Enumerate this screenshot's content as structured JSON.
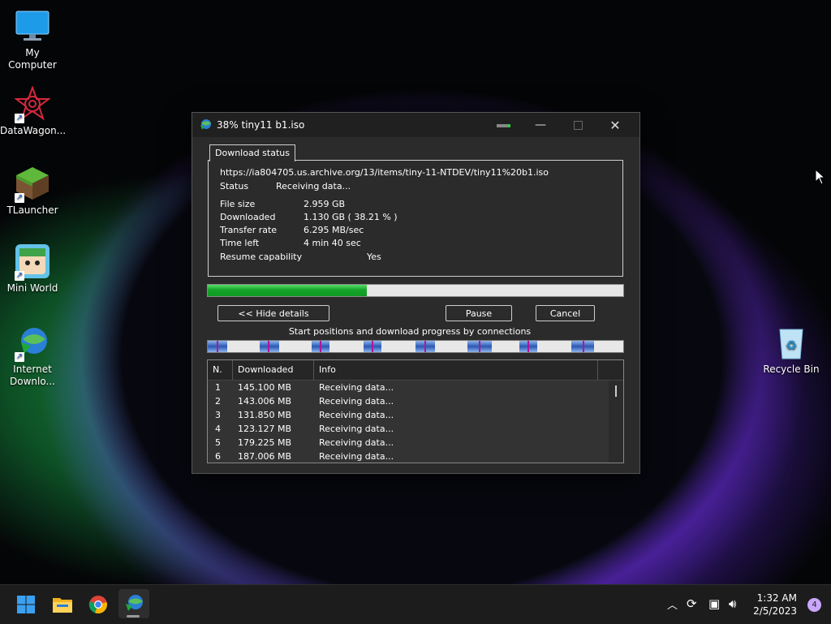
{
  "desktop": {
    "icons": [
      {
        "label": "My Computer"
      },
      {
        "label": "DataWagon..."
      },
      {
        "label": "TLauncher"
      },
      {
        "label": "Mini World"
      },
      {
        "label": "Internet Downlo..."
      },
      {
        "label": "Recycle Bin"
      }
    ]
  },
  "window": {
    "title": "38% tiny11 b1.iso",
    "tab_label": "Download status",
    "url": "https://ia804705.us.archive.org/13/items/tiny-11-NTDEV/tiny11%20b1.iso",
    "status_label": "Status",
    "status_value": "Receiving data...",
    "file_size_label": "File size",
    "file_size_value": "2.959  GB",
    "downloaded_label": "Downloaded",
    "downloaded_value": "1.130  GB  ( 38.21 % )",
    "transfer_rate_label": "Transfer rate",
    "transfer_rate_value": "6.295  MB/sec",
    "time_left_label": "Time left",
    "time_left_value": "4 min 40 sec",
    "resume_label": "Resume capability",
    "resume_value": "Yes",
    "progress_fraction": 0.3821,
    "hide_details_label": "<< Hide details",
    "pause_label": "Pause",
    "cancel_label": "Cancel",
    "connections_caption": "Start positions and download progress by connections",
    "table": {
      "headers": [
        "N.",
        "Downloaded",
        "Info"
      ],
      "rows": [
        {
          "n": "1",
          "downloaded": "145.100  MB",
          "info": "Receiving data..."
        },
        {
          "n": "2",
          "downloaded": "143.006  MB",
          "info": "Receiving data..."
        },
        {
          "n": "3",
          "downloaded": "131.850  MB",
          "info": "Receiving data..."
        },
        {
          "n": "4",
          "downloaded": "123.127  MB",
          "info": "Receiving data..."
        },
        {
          "n": "5",
          "downloaded": "179.225  MB",
          "info": "Receiving data..."
        },
        {
          "n": "6",
          "downloaded": "187.006  MB",
          "info": "Receiving data..."
        }
      ]
    }
  },
  "taskbar": {
    "clock_time": "1:32 AM",
    "clock_date": "2/5/2023",
    "notification_count": "4"
  },
  "colors": {
    "progress_green": "#15a32a",
    "connection_blue": "#2b57b4",
    "connection_mark": "#b0169a"
  }
}
